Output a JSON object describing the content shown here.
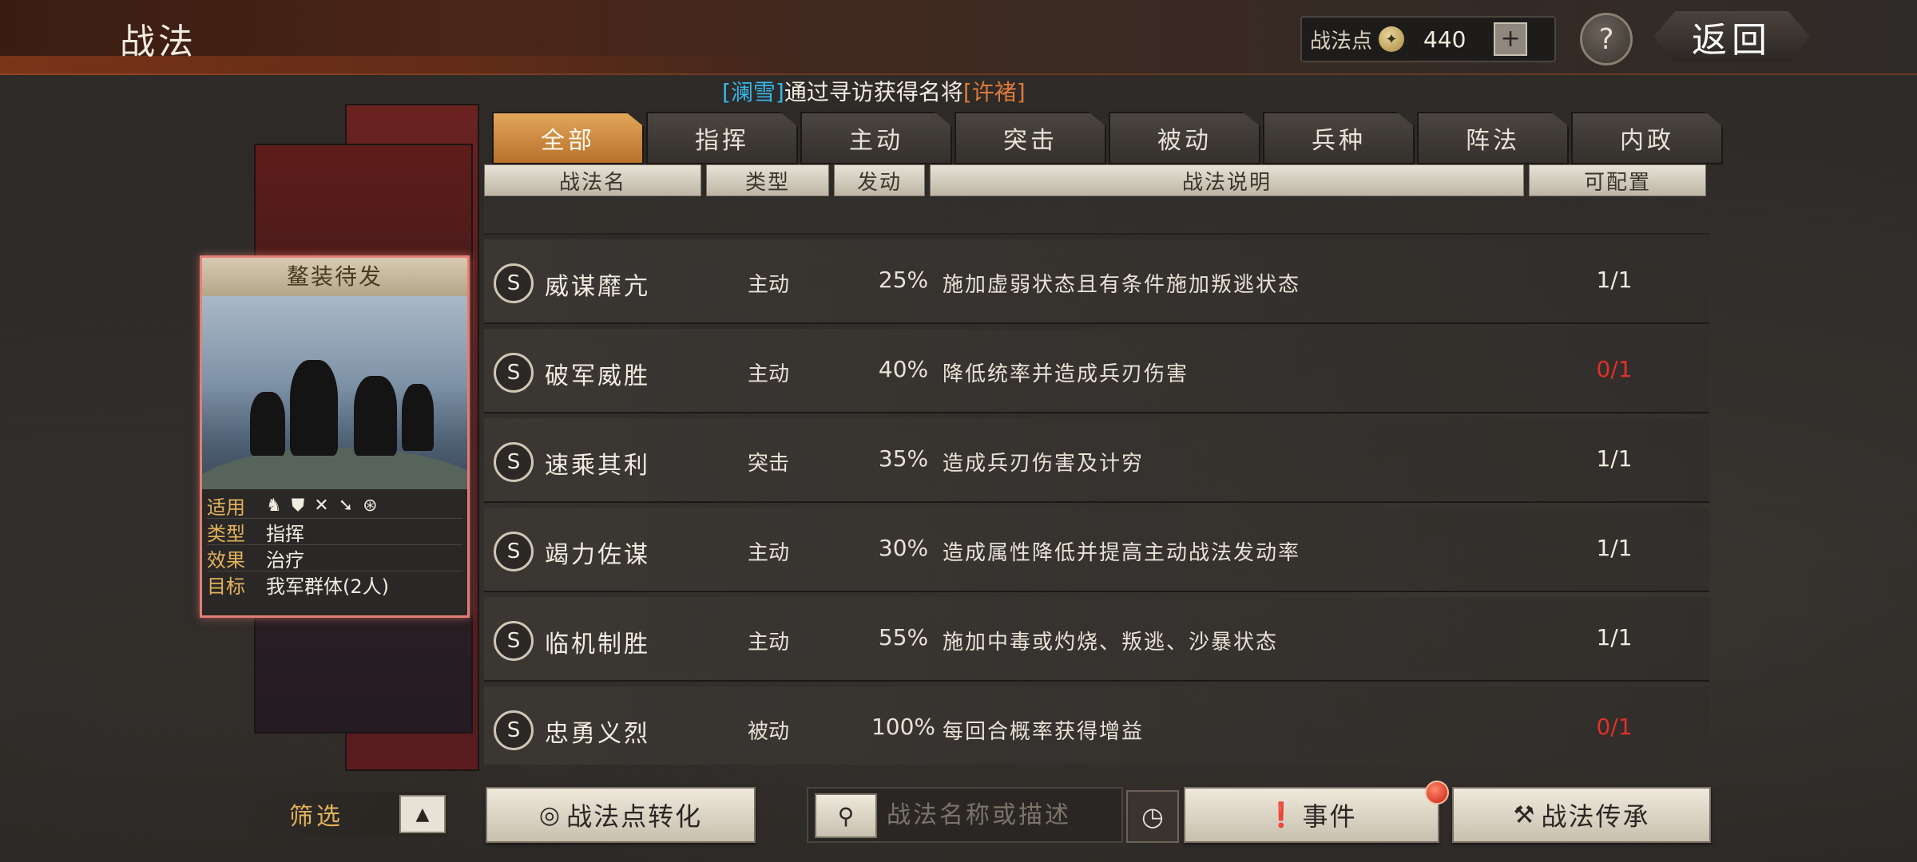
{
  "header": {
    "title": "战法",
    "points_label": "战法点",
    "points_value": "440",
    "plus_label": "+",
    "help_label": "?",
    "back_label": "返回"
  },
  "notice": {
    "part1": "[澜雪]",
    "part2": "通过寻访获得名将",
    "part3": "[许褚]"
  },
  "card": {
    "title": "鳌装待发",
    "applicable_label": "适用",
    "applicable_icons": [
      "cavalry-icon",
      "shield-icon",
      "archer-icon",
      "spear-icon",
      "wheel-icon"
    ],
    "rows": [
      {
        "key": "类型",
        "value": "指挥"
      },
      {
        "key": "效果",
        "value": "治疗"
      },
      {
        "key": "目标",
        "value": "我军群体(2人)"
      }
    ]
  },
  "tabs": [
    "全部",
    "指挥",
    "主动",
    "突击",
    "被动",
    "兵种",
    "阵法",
    "内政"
  ],
  "active_tab": 0,
  "table": {
    "headers": [
      "战法名",
      "类型",
      "发动",
      "战法说明",
      "可配置"
    ],
    "rows": [
      {
        "grade": "S",
        "name": "威谋靡亢",
        "type": "主动",
        "rate": "25%",
        "desc": "施加虚弱状态且有条件施加叛逃状态",
        "avail": "1/1"
      },
      {
        "grade": "S",
        "name": "破军威胜",
        "type": "主动",
        "rate": "40%",
        "desc": "降低统率并造成兵刃伤害",
        "avail": "0/1"
      },
      {
        "grade": "S",
        "name": "速乘其利",
        "type": "突击",
        "rate": "35%",
        "desc": "造成兵刃伤害及计穷",
        "avail": "1/1"
      },
      {
        "grade": "S",
        "name": "竭力佐谋",
        "type": "主动",
        "rate": "30%",
        "desc": "造成属性降低并提高主动战法发动率",
        "avail": "1/1"
      },
      {
        "grade": "S",
        "name": "临机制胜",
        "type": "主动",
        "rate": "55%",
        "desc": "施加中毒或灼烧、叛逃、沙暴状态",
        "avail": "1/1"
      },
      {
        "grade": "S",
        "name": "忠勇义烈",
        "type": "被动",
        "rate": "100%",
        "desc": "每回合概率获得增益",
        "avail": "0/1"
      }
    ]
  },
  "bottom": {
    "filter_label": "筛选",
    "convert_label": "战法点转化",
    "search_placeholder": "战法名称或描述",
    "events_label": "事件",
    "inherit_label": "战法传承"
  },
  "colors": {
    "accent_tab": "#d08a40",
    "unavailable": "#e0302a",
    "notice_name": "#38b6e8",
    "notice_general": "#e07a3a"
  }
}
